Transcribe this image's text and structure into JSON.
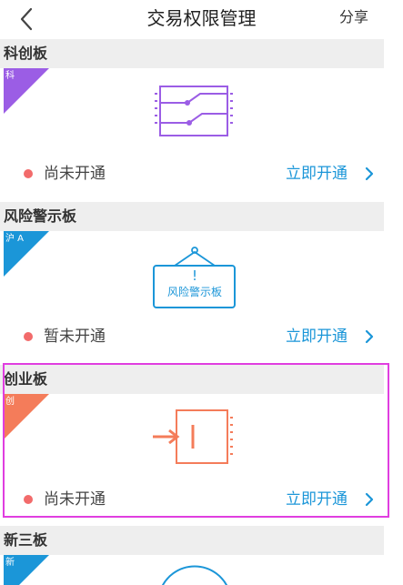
{
  "header": {
    "title": "交易权限管理",
    "share_label": "分享"
  },
  "sections": [
    {
      "title": "科创板",
      "ribbon_label": "科",
      "ribbon_color": "#9b5de5",
      "icon": "switch-board-icon",
      "icon_color": "#9b5de5",
      "status": "尚未开通",
      "action": "立即开通"
    },
    {
      "title": "风险警示板",
      "ribbon_label": "沪 A",
      "ribbon_color": "#1b96d8",
      "icon": "warning-sign-icon",
      "icon_color": "#1b96d8",
      "sign_mark": "!",
      "sign_text": "风险警示板",
      "status": "暂未开通",
      "action": "立即开通"
    },
    {
      "title": "创业板",
      "ribbon_label": "创",
      "ribbon_color": "#f47c5a",
      "icon": "enter-board-icon",
      "icon_color": "#f47c5a",
      "status": "尚未开通",
      "action": "立即开通"
    },
    {
      "title": "新三板",
      "ribbon_label": "新",
      "ribbon_color": "#1b96d8",
      "icon": "circle-arc-icon",
      "icon_color": "#1b96d8"
    }
  ],
  "colors": {
    "status_dot": "#f26b6b",
    "link": "#1b96d8",
    "highlight": "#e03ee0"
  }
}
